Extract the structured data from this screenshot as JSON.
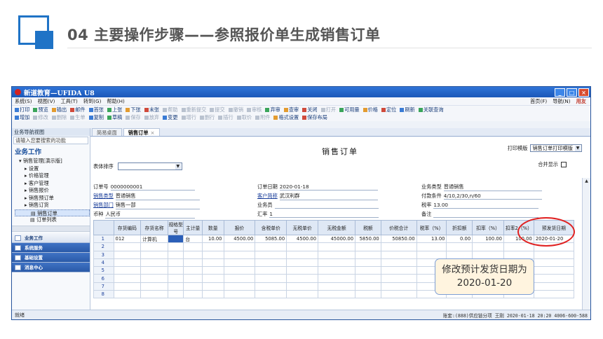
{
  "slide": {
    "title": "04  主要操作步骤——参照报价单生成销售订单"
  },
  "window": {
    "title": "新道教育—UFIDA U8",
    "buttons": [
      "_",
      "□",
      "×"
    ]
  },
  "menubar": {
    "items": [
      "系统(S)",
      "视图(V)",
      "工具(T)",
      "转到(G)",
      "帮助(H)"
    ],
    "right": [
      "首页(F)",
      "导航(N)"
    ],
    "brand": "用友"
  },
  "toolbar1": [
    {
      "label": "打印",
      "state": "on"
    },
    {
      "label": "预览",
      "state": "on"
    },
    {
      "label": "输出",
      "state": "on"
    },
    {
      "label": "邮件",
      "state": "on"
    },
    {
      "label": "首张",
      "state": "on"
    },
    {
      "label": "上张",
      "state": "on"
    },
    {
      "label": "下张",
      "state": "on"
    },
    {
      "label": "末张",
      "state": "on"
    },
    {
      "label": "帮助",
      "state": "dim"
    },
    {
      "label": "重新提交",
      "state": "dim"
    },
    {
      "label": "提交",
      "state": "dim"
    },
    {
      "label": "撤销",
      "state": "dim"
    },
    {
      "label": "审核",
      "state": "dim"
    },
    {
      "label": "弃审",
      "state": "on"
    },
    {
      "label": "查审",
      "state": "on"
    },
    {
      "label": "关闭",
      "state": "on"
    },
    {
      "label": "打开",
      "state": "dim"
    },
    {
      "label": "可用量",
      "state": "on"
    },
    {
      "label": "价格",
      "state": "on"
    },
    {
      "label": "定位",
      "state": "on"
    },
    {
      "label": "刷新",
      "state": "on"
    },
    {
      "label": "关联查询",
      "state": "on"
    }
  ],
  "toolbar2": [
    {
      "label": "增加",
      "state": "on"
    },
    {
      "label": "修改",
      "state": "dim"
    },
    {
      "label": "删除",
      "state": "dim"
    },
    {
      "label": "生单",
      "state": "dim"
    },
    {
      "label": "复制",
      "state": "on"
    },
    {
      "label": "草稿",
      "state": "on"
    },
    {
      "label": "保存",
      "state": "dim"
    },
    {
      "label": "放弃",
      "state": "dim"
    },
    {
      "label": "变更",
      "state": "on"
    },
    {
      "label": "增行",
      "state": "dim"
    },
    {
      "label": "删行",
      "state": "dim"
    },
    {
      "label": "插行",
      "state": "dim"
    },
    {
      "label": "取价",
      "state": "dim"
    },
    {
      "label": "附件",
      "state": "dim"
    },
    {
      "label": "格式设置",
      "state": "on"
    },
    {
      "label": "保存布局",
      "state": "on"
    }
  ],
  "nav": {
    "header": "业务导航视图",
    "search_placeholder": "请输入您要搜索的功能",
    "section": "业务工作",
    "tree": [
      {
        "label": "销售管理[演示版]",
        "level": 0
      },
      {
        "label": "设置",
        "level": 1
      },
      {
        "label": "价格管理",
        "level": 1
      },
      {
        "label": "客户管理",
        "level": 1
      },
      {
        "label": "销售报价",
        "level": 1
      },
      {
        "label": "销售预订单",
        "level": 1
      },
      {
        "label": "销售订货",
        "level": 1
      },
      {
        "label": "销售订单",
        "level": 2,
        "selected": true
      },
      {
        "label": "订单列表",
        "level": 2
      }
    ],
    "modules": [
      {
        "label": "业务工作",
        "active": true
      },
      {
        "label": "系统服务",
        "active": false
      },
      {
        "label": "基础设置",
        "active": false
      },
      {
        "label": "消息中心",
        "active": false
      }
    ]
  },
  "tabs": [
    {
      "label": "简易桌面",
      "active": false
    },
    {
      "label": "销售订单",
      "active": true,
      "close": "×"
    }
  ],
  "document": {
    "title": "销售订单",
    "print_template_label": "打印模版",
    "print_template_value": "销售订单打印模版",
    "merge_label": "合并显示",
    "sort_label": "表体排序",
    "fields": {
      "order_no": {
        "label": "订单号",
        "value": "0000000001"
      },
      "order_date": {
        "label": "订单日期",
        "value": "2020-01-18"
      },
      "biz_type": {
        "label": "业务类型",
        "value": "普通销售"
      },
      "sales_type": {
        "label": "销售类型",
        "value": "普通销售"
      },
      "customer": {
        "label": "客户简称",
        "value": "武汉利群"
      },
      "pay_terms": {
        "label": "付款条件",
        "value": "4/10,2/30,n/60"
      },
      "dept": {
        "label": "销售部门",
        "value": "销售一部"
      },
      "salesman": {
        "label": "业务员",
        "value": ""
      },
      "tax_rate": {
        "label": "税率",
        "value": "13.00"
      },
      "currency": {
        "label": "币种",
        "value": "人民币"
      },
      "exchange": {
        "label": "汇率",
        "value": "1"
      },
      "remark": {
        "label": "备注",
        "value": ""
      }
    },
    "columns": [
      "",
      "存货编码",
      "存货名称",
      "规格型号",
      "主计量",
      "数量",
      "报价",
      "含税单价",
      "无税单价",
      "无税金额",
      "税额",
      "价税合计",
      "税率（%）",
      "折扣额",
      "扣率（%）",
      "扣率2（%）",
      "预发货日期"
    ],
    "rows": [
      [
        "1",
        "012",
        "计算机",
        "",
        "台",
        "10.00",
        "4500.00",
        "5085.00",
        "4500.00",
        "45000.00",
        "5850.00",
        "50850.00",
        "13.00",
        "0.00",
        "100.00",
        "100.00",
        "2020-01-20"
      ],
      [
        "2",
        "",
        "",
        "",
        "",
        "",
        "",
        "",
        "",
        "",
        "",
        "",
        "",
        "",
        "",
        "",
        ""
      ],
      [
        "3",
        "",
        "",
        "",
        "",
        "",
        "",
        "",
        "",
        "",
        "",
        "",
        "",
        "",
        "",
        "",
        ""
      ],
      [
        "4",
        "",
        "",
        "",
        "",
        "",
        "",
        "",
        "",
        "",
        "",
        "",
        "",
        "",
        "",
        "",
        ""
      ],
      [
        "5",
        "",
        "",
        "",
        "",
        "",
        "",
        "",
        "",
        "",
        "",
        "",
        "",
        "",
        "",
        "",
        ""
      ],
      [
        "6",
        "",
        "",
        "",
        "",
        "",
        "",
        "",
        "",
        "",
        "",
        "",
        "",
        "",
        "",
        "",
        ""
      ],
      [
        "7",
        "",
        "",
        "",
        "",
        "",
        "",
        "",
        "",
        "",
        "",
        "",
        "",
        "",
        "",
        "",
        ""
      ],
      [
        "8",
        "",
        "",
        "",
        "",
        "",
        "",
        "",
        "",
        "",
        "",
        "",
        "",
        "",
        "",
        "",
        ""
      ]
    ]
  },
  "statusbar": {
    "left": "就绪",
    "right": "账套:(888)供应链分项  王刚  2020-01-18 20:20  4006-600-588"
  },
  "callout": {
    "line1": "修改预计发货日期为",
    "line2": "2020-01-20"
  }
}
